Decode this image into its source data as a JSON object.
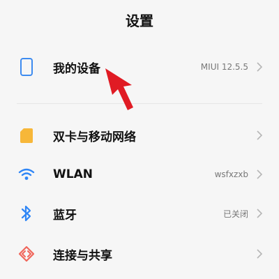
{
  "header": {
    "title": "设置"
  },
  "rows": [
    {
      "label": "我的设备",
      "value": "MIUI 12.5.5",
      "icon": "phone-outline-icon",
      "color": "#3d8bf0"
    },
    {
      "label": "双卡与移动网络",
      "value": "",
      "icon": "sim-card-icon",
      "color": "#f7b739"
    },
    {
      "label": "WLAN",
      "value": "wsfxzxb",
      "icon": "wifi-icon",
      "color": "#2f86f6"
    },
    {
      "label": "蓝牙",
      "value": "已关闭",
      "icon": "bluetooth-icon",
      "color": "#2f86f6"
    },
    {
      "label": "连接与共享",
      "value": "",
      "icon": "connection-share-icon",
      "color": "#f0665b"
    }
  ],
  "colors": {
    "background": "#f6f6f6",
    "arrow": "#e01b24",
    "chevron": "#b6b6b6"
  }
}
